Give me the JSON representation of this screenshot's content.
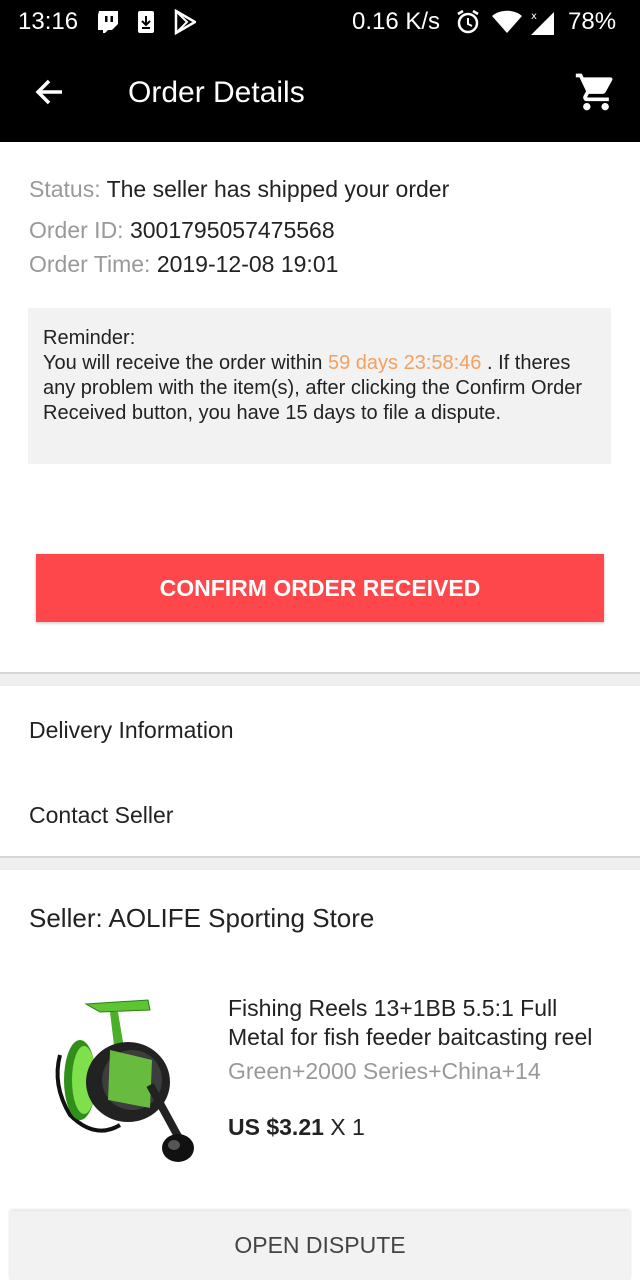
{
  "status_bar": {
    "time": "13:16",
    "speed": "0.16 K/s",
    "battery": "78%",
    "icons": [
      "twitch-icon",
      "download-icon",
      "play-store-icon",
      "alarm-icon",
      "wifi-icon",
      "signal-icon"
    ]
  },
  "app_bar": {
    "title": "Order Details",
    "back_icon": "back-arrow-icon",
    "cart_icon": "cart-icon"
  },
  "order": {
    "status_label": "Status:",
    "status_value": "The seller has shipped your order",
    "id_label": "Order ID:",
    "id_value": "3001795057475568",
    "time_label": "Order Time:",
    "time_value": "2019-12-08 19:01"
  },
  "reminder": {
    "heading": "Reminder:",
    "text_before": "You will receive the order within ",
    "countdown": "59 days 23:58:46",
    "text_after": " . If theres any problem with the item(s), after clicking the Confirm Order Received button, you have 15 days to file a dispute."
  },
  "buttons": {
    "confirm": "CONFIRM ORDER RECEIVED",
    "dispute": "OPEN DISPUTE"
  },
  "links": {
    "delivery": "Delivery Information",
    "contact": "Contact Seller"
  },
  "seller": {
    "label": "Seller: AOLIFE Sporting Store"
  },
  "product": {
    "name_line1": "Fishing Reels 13+1BB 5.5:1 Full",
    "name_line2": "Metal for fish feeder baitcasting reel",
    "variant": "Green+2000 Series+China+14",
    "price": "US $3.21",
    "quantity": "X 1"
  },
  "colors": {
    "accent_red": "#fd474a",
    "highlight_orange": "#f3a061",
    "label_gray": "#999999"
  }
}
